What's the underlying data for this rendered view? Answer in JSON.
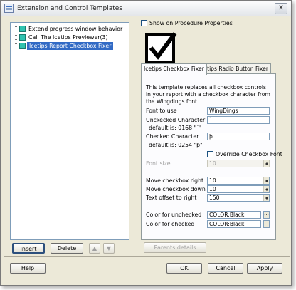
{
  "window": {
    "title": "Extension and Control Templates",
    "close_glyph": "✕"
  },
  "tree": {
    "items": [
      {
        "label": "Extend progress window behavior"
      },
      {
        "label": "Call The Icetips Previewer(3)"
      },
      {
        "label": "Icetips Report Checkbox Fixer"
      }
    ]
  },
  "left_buttons": {
    "insert": "Insert",
    "delete": "Delete",
    "up_glyph": "▲",
    "down_glyph": "▼"
  },
  "show_on_procedure": "Show on Procedure Properties",
  "big_check_icon": "checkmark-icon",
  "tabs": [
    "Icetips Checkbox Fixer",
    "Icetips Radio Button Fixer"
  ],
  "description": "This template replaces all checkbox controls in your report with a checkbox character from the Wingdings font.",
  "form": {
    "font_to_use_label": "Font to use",
    "font_to_use_value": "WingDings",
    "unchecked_label": "Unckecked Character",
    "unchecked_value": "¨",
    "unchecked_default": "default is: 0168 \"¨\"",
    "checked_label": "Checked Character",
    "checked_value": "þ",
    "checked_default": "default is: 0254 \"þ\"",
    "override_label": "Override Checkbox Font",
    "font_size_label": "Font size",
    "font_size_value": "10",
    "move_right_label": "Move checkbox right",
    "move_right_value": "10",
    "move_down_label": "Move checkbox down",
    "move_down_value": "10",
    "text_offset_label": "Text offset to right",
    "text_offset_value": "150",
    "color_unchecked_label": "Color for unchecked",
    "color_unchecked_value": "COLOR:Black",
    "color_checked_label": "Color for checked",
    "color_checked_value": "COLOR:Black",
    "dots": "..."
  },
  "parents_details": "Parents details",
  "bottom_buttons": {
    "help": "Help",
    "ok": "OK",
    "cancel": "Cancel",
    "apply": "Apply"
  },
  "colors": {
    "selection": "#316ac5",
    "dialog_bg": "#ece9d8",
    "tree_icon": "#2fc3b0"
  }
}
